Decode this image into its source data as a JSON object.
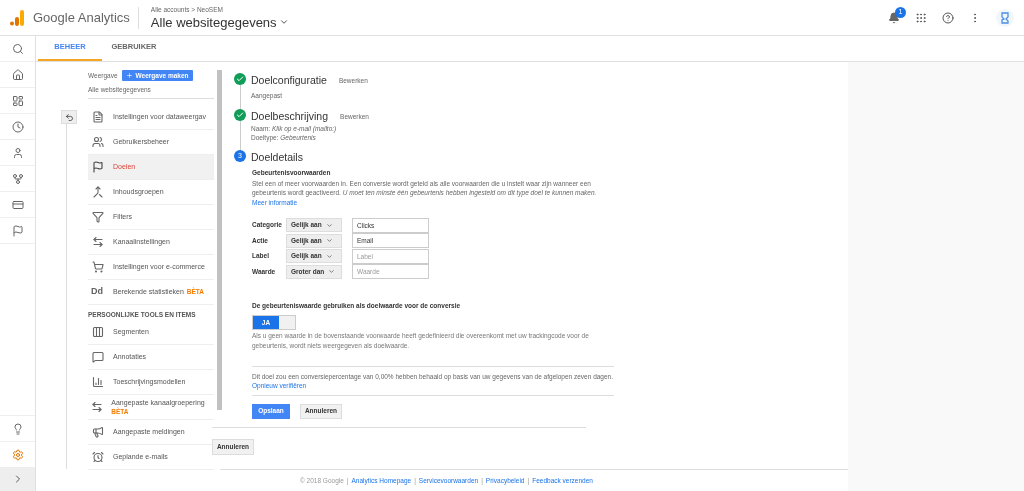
{
  "header": {
    "product": "Google Analytics",
    "breadcrumb": "Alle accounts > NeoSEM",
    "view": "Alle websitegegevens",
    "notifications": "1"
  },
  "rail": {
    "top": [
      {
        "kind": "search",
        "selected": false
      },
      {
        "kind": "home",
        "selected": false
      },
      {
        "kind": "dashboard",
        "selected": false
      },
      {
        "kind": "clock",
        "selected": false
      },
      {
        "kind": "person",
        "selected": false
      },
      {
        "kind": "flow",
        "selected": false
      },
      {
        "kind": "card",
        "selected": false
      },
      {
        "kind": "flag",
        "selected": false
      }
    ],
    "bottom": [
      {
        "kind": "bulb",
        "selected": false
      },
      {
        "kind": "gear",
        "selected": true
      }
    ]
  },
  "tabs": [
    {
      "label": "BEHEER",
      "selected": true
    },
    {
      "label": "GEBRUIKER",
      "selected": false
    }
  ],
  "view_panel": {
    "label": "Weergave",
    "create_button": "Weergave maken",
    "current": "Alle websitegegevens"
  },
  "sidebar": {
    "items": [
      {
        "kind": "doc",
        "label": "Instellingen voor dataweergav",
        "selected": false
      },
      {
        "kind": "people",
        "label": "Gebruikersbeheer",
        "selected": false
      },
      {
        "kind": "flag",
        "label": "Doelen",
        "selected": true
      },
      {
        "kind": "merge",
        "label": "Inhoudsgroepen",
        "selected": false
      },
      {
        "kind": "filter",
        "label": "Filters",
        "selected": false
      },
      {
        "kind": "channel",
        "label": "Kanaalinstellingen",
        "selected": false
      },
      {
        "kind": "cart",
        "label": "Instellingen voor e-commerce",
        "selected": false
      },
      {
        "kind": "dd",
        "icon_text": "Dd",
        "label": "Berekende statistieken",
        "badge": "BÈTA",
        "selected": false
      }
    ],
    "section": "PERSOONLIJKE TOOLS EN ITEMS",
    "personal": [
      {
        "kind": "segments",
        "label": "Segmenten",
        "selected": false
      },
      {
        "kind": "comment",
        "label": "Annotaties",
        "selected": false
      },
      {
        "kind": "bars",
        "label": "Toeschrijvingsmodellen",
        "selected": false
      },
      {
        "kind": "channel",
        "label": "Aangepaste kanaalgroepering",
        "badge": "BÈTA",
        "selected": false
      },
      {
        "kind": "megaphone",
        "label": "Aangepaste meldingen",
        "selected": false
      },
      {
        "kind": "alarm",
        "label": "Geplande e-mails",
        "selected": false
      }
    ]
  },
  "steps": [
    {
      "completed": true,
      "title": "Doelconfiguratie",
      "edit": "Bewerken",
      "lines": [
        {
          "text": "Aangepast"
        }
      ]
    },
    {
      "completed": true,
      "title": "Doelbeschrijving",
      "edit": "Bewerken",
      "lines": [
        {
          "label": "Naam:",
          "value": "Klik op e-mail (mailto:)"
        },
        {
          "label": "Doeltype:",
          "value": "Gebeurtenis"
        }
      ]
    },
    {
      "completed": false,
      "marker": "3",
      "title": "Doeldetails"
    }
  ],
  "conditions": {
    "title": "Gebeurtenisvoorwaarden",
    "intro": "Stel een of meer voorwaarden in. Een conversie wordt geteld als alle voorwaarden die u instelt waar zijn wanneer een gebeurtenis wordt geactiveerd. *U moet ten minste één gebeurtenis hebben ingesteld om dit type doel te kunnen maken.*",
    "more_link": "Meer informatie",
    "rows": [
      {
        "label": "Categorie",
        "operator": "Gelijk aan",
        "value": "Clicks"
      },
      {
        "label": "Actie",
        "operator": "Gelijk aan",
        "value": "Email"
      },
      {
        "label": "Label",
        "operator": "Gelijk aan",
        "placeholder": "Label"
      },
      {
        "label": "Waarde",
        "operator": "Groter dan",
        "placeholder": "Waarde"
      }
    ]
  },
  "event_value": {
    "title": "De gebeurteniswaarde gebruiken als doelwaarde voor de conversie",
    "toggle_label": "JA",
    "on": true,
    "note": "Als u geen waarde in de bovenstaande voorwaarde heeft gedefinieerd die overeenkomt met uw trackingcode voor de gebeurtenis, wordt niets weergegeven als doelwaarde."
  },
  "verify": {
    "text": "Dit doel zou een conversiepercentage van 0,00% hebben behaald op basis van uw gegevens van de afgelopen zeven dagen.",
    "link": "Opnieuw verifiëren"
  },
  "actions": {
    "save": "Opslaan",
    "cancel": "Annuleren"
  },
  "outer_cancel": "Annuleren",
  "footer": {
    "copyright": "© 2018 Google",
    "separator": "|",
    "links": [
      "Analytics Homepage",
      "Servicevoorwaarden",
      "Privacybeleid",
      "Feedback verzenden"
    ]
  }
}
